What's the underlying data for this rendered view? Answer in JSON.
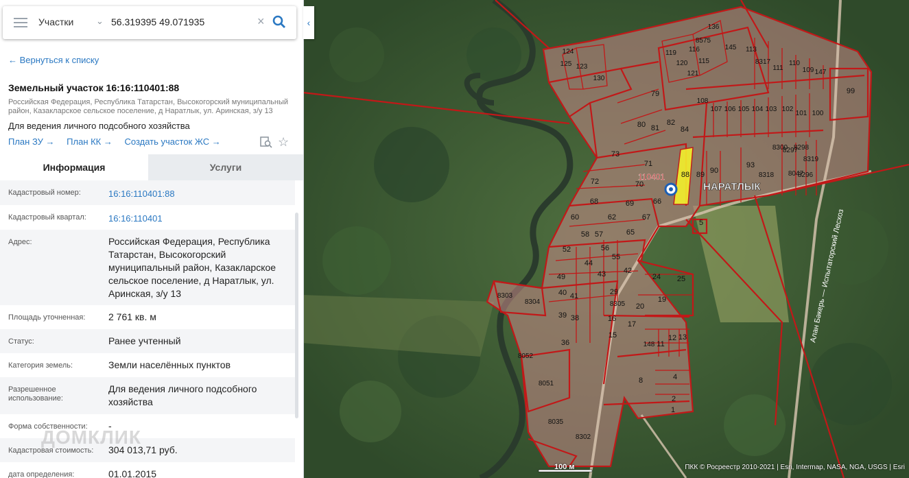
{
  "search": {
    "layer": "Участки",
    "query": "56.319395 49.071935"
  },
  "panel": {
    "back_link": "← Вернуться к списку",
    "title": "Земельный участок 16:16:110401:88",
    "address_line1": "Российская Федерация, Республика Татарстан, Высокогорский муниципальный",
    "address_line2": "район, Казакларское сельское поселение, д Наратлык, ул. Аринская, з/у 13",
    "purpose": "Для ведения личного подсобного хозяйства",
    "links": [
      "План ЗУ →",
      "План КК →",
      "Создать участок ЖС →"
    ],
    "tabs": [
      "Информация",
      "Услуги"
    ],
    "fields": [
      {
        "label": "Кадастровый номер:",
        "value": "16:16:110401:88",
        "link": true
      },
      {
        "label": "Кадастровый квартал:",
        "value": "16:16:110401",
        "link": true
      },
      {
        "label": "Адрес:",
        "value": [
          "Российская Федерация, Республика",
          "Татарстан, Высокогорский",
          "муниципальный район, Казакларское",
          "сельское поселение, д Наратлык, ул.",
          "Аринская, з/у 13"
        ]
      },
      {
        "label": "Площадь уточненная:",
        "value": "2 761 кв. м"
      },
      {
        "label": "Статус:",
        "value": "Ранее учтенный"
      },
      {
        "label": "Категория земель:",
        "value": "Земли населённых пунктов"
      },
      {
        "label": [
          "Разрешенное",
          "использование:"
        ],
        "value": [
          "Для ведения личного подсобного",
          "хозяйства"
        ]
      },
      {
        "label": "Форма собственности:",
        "value": "-"
      },
      {
        "label": "Кадастровая стоимость:",
        "value": "304 013,71 руб."
      },
      {
        "label": "дата определения:",
        "value": "01.01.2015"
      }
    ]
  },
  "watermark": "ДОМКЛИК",
  "map": {
    "place_name": "НАРАТЛЫК",
    "quarter_label": "110401",
    "road_label": "Алан Бәкерь — Испытаторский Лесхоз",
    "parcel_labels": [
      "136",
      "8575",
      "145",
      "113",
      "8317",
      "111",
      "110",
      "109",
      "147",
      "124",
      "125",
      "123",
      "130",
      "119",
      "120",
      "116",
      "115",
      "121",
      "99",
      "108",
      "107",
      "106",
      "105",
      "104",
      "103",
      "102",
      "101",
      "100",
      "79",
      "80",
      "81",
      "82",
      "84",
      "8300",
      "8297",
      "8298",
      "8319",
      "73",
      "71",
      "70",
      "88",
      "89",
      "90",
      "93",
      "8318",
      "8047",
      "8296",
      "72",
      "69",
      "68",
      "67",
      "62",
      "66",
      "5",
      "60",
      "58",
      "57",
      "56",
      "55",
      "65",
      "52",
      "49",
      "44",
      "43",
      "42",
      "24",
      "25",
      "8303",
      "8304",
      "40",
      "41",
      "29",
      "8305",
      "20",
      "19",
      "39",
      "38",
      "16",
      "17",
      "36",
      "15",
      "148",
      "11",
      "12",
      "13",
      "8052",
      "8",
      "4",
      "8051",
      "2",
      "1",
      "8035",
      "8302"
    ],
    "selected_parcel": "88",
    "scale_label": "100 м",
    "attribution": "ПКК © Росреестр 2010-2021 | Esri, Intermap, NASA, NGA, USGS | Esri"
  }
}
